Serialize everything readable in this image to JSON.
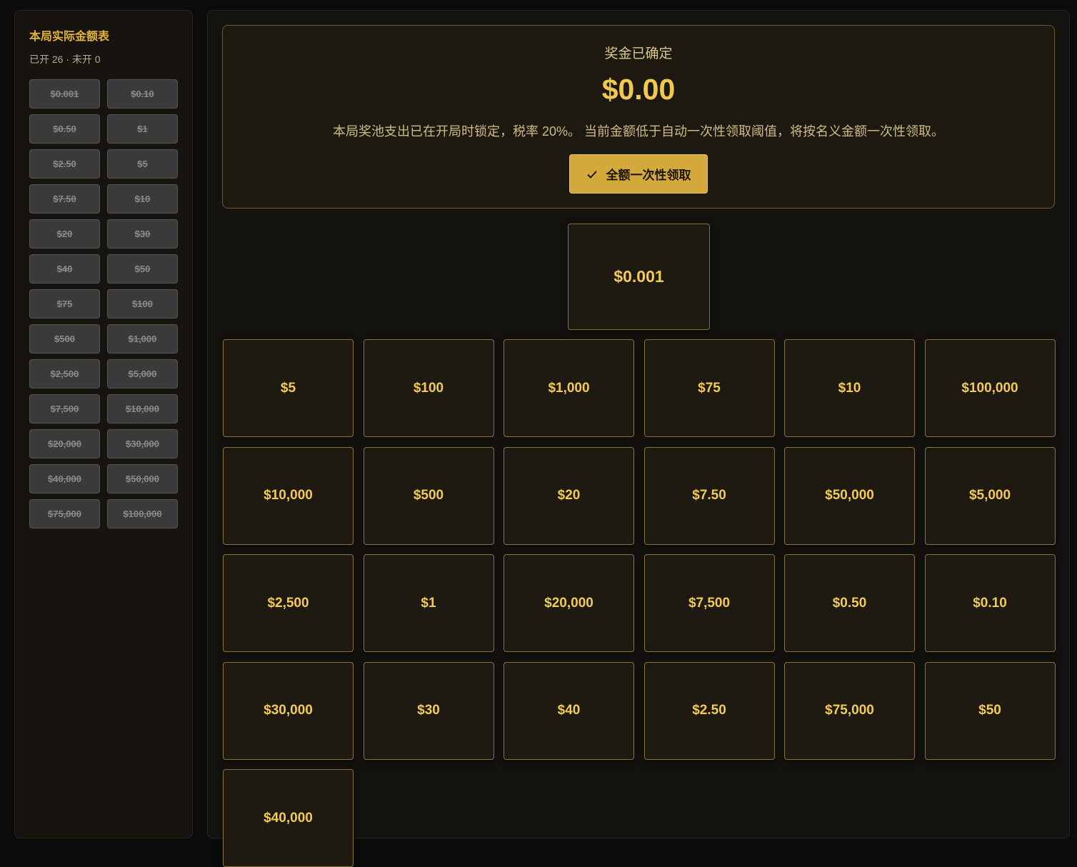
{
  "sidebar": {
    "title": "本局实际金额表",
    "subtitle": "已开 26 · 未开 0",
    "amounts": [
      "$0.001",
      "$0.10",
      "$0.50",
      "$1",
      "$2.50",
      "$5",
      "$7.50",
      "$10",
      "$20",
      "$30",
      "$40",
      "$50",
      "$75",
      "$100",
      "$500",
      "$1,000",
      "$2,500",
      "$5,000",
      "$7,500",
      "$10,000",
      "$20,000",
      "$30,000",
      "$40,000",
      "$50,000",
      "$75,000",
      "$100,000"
    ]
  },
  "banner": {
    "heading": "奖金已确定",
    "amount": "$0.00",
    "description": "本局奖池支出已在开局时锁定，税率 20%。 当前金额低于自动一次性领取阈值，将按名义金额一次性领取。",
    "claim_label": "全额一次性领取",
    "claim_icon": "check-icon"
  },
  "featured_case": "$0.001",
  "cases": [
    "$5",
    "$100",
    "$1,000",
    "$75",
    "$10",
    "$100,000",
    "$10,000",
    "$500",
    "$20",
    "$7.50",
    "$50,000",
    "$5,000",
    "$2,500",
    "$1",
    "$20,000",
    "$7,500",
    "$0.50",
    "$0.10",
    "$30,000",
    "$30",
    "$40",
    "$2.50",
    "$75,000",
    "$50",
    "$40,000"
  ],
  "colors": {
    "accent": "#e2b33c",
    "button": "#d4a93c",
    "case_border": "#8a7232"
  }
}
